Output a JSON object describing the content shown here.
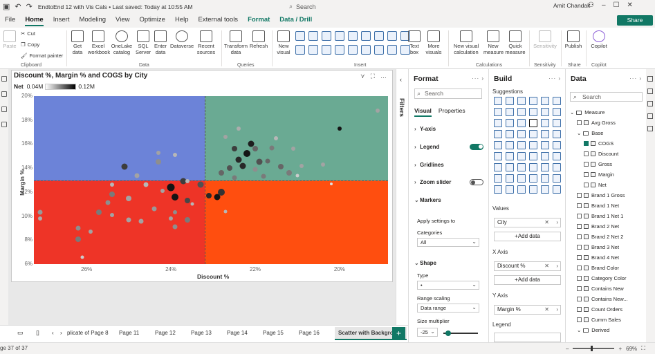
{
  "titlebar": {
    "file_title": "EndtoEnd 12 with Vis Cals • Last saved: Today at 10:55 AM",
    "search_placeholder": "Search",
    "user": "Amit Chandak"
  },
  "menu": {
    "tabs": [
      "File",
      "Home",
      "Insert",
      "Modeling",
      "View",
      "Optimize",
      "Help",
      "External tools",
      "Format",
      "Data / Drill"
    ],
    "active": "Home",
    "share_label": "Share"
  },
  "ribbon": {
    "clipboard": {
      "paste": "Paste",
      "cut": "Cut",
      "copy": "Copy",
      "format_painter": "Format painter",
      "group": "Clipboard"
    },
    "data": {
      "get_data": "Get data",
      "excel": "Excel workbook",
      "onelake": "OneLake catalog",
      "sql": "SQL Server",
      "enter": "Enter data",
      "dataverse": "Dataverse",
      "recent": "Recent sources",
      "group": "Data"
    },
    "queries": {
      "transform": "Transform data",
      "refresh": "Refresh",
      "group": "Queries"
    },
    "insert": {
      "new_visual": "New visual",
      "text_box": "Text box",
      "more_visuals": "More visuals",
      "group": "Insert"
    },
    "calculations": {
      "new_visual_calc": "New visual calculation",
      "new_measure": "New measure",
      "quick_measure": "Quick measure",
      "group": "Calculations"
    },
    "sensitivity": {
      "label": "Sensitivity",
      "group": "Sensitivity"
    },
    "share": {
      "publish": "Publish",
      "group": "Share"
    },
    "copilot": {
      "label": "Copilot",
      "group": "Copilot"
    }
  },
  "visual": {
    "title": "Discount %, Margin % and COGS by City",
    "legend_title": "Net",
    "legend_min": "0.04M",
    "legend_max": "0.12M",
    "quadrant_colors": {
      "top_left": "#6c83d8",
      "top_right": "#6aaa93",
      "bottom_left": "#ee3427",
      "bottom_right": "#ff4e0f"
    }
  },
  "chart_data": {
    "type": "scatter",
    "title": "Discount %, Margin % and COGS by City",
    "xlabel": "Discount %",
    "ylabel": "Margin %",
    "x_reversed": true,
    "xlim": [
      27.25,
      18.85
    ],
    "ylim": [
      6,
      20
    ],
    "x_ticks": [
      "26%",
      "24%",
      "22%",
      "20%"
    ],
    "y_ticks": [
      "20%",
      "18%",
      "16%",
      "14%",
      "12%",
      "10%",
      "8%",
      "6%"
    ],
    "x_tick_values": [
      26,
      24,
      22,
      20
    ],
    "y_tick_values": [
      20,
      18,
      16,
      14,
      12,
      10,
      8,
      6
    ],
    "reference_x": 23.2,
    "reference_y": 13.0,
    "grid": false,
    "legend": "top-left gradient",
    "points": [
      {
        "x": 22.8,
        "y": 12.0,
        "shade": 0.85,
        "size": 10
      },
      {
        "x": 23.7,
        "y": 12.9,
        "shade": 0.8,
        "size": 9
      },
      {
        "x": 24.0,
        "y": 12.4,
        "shade": 1.0,
        "size": 11
      },
      {
        "x": 23.3,
        "y": 12.6,
        "shade": 0.7,
        "size": 9
      },
      {
        "x": 22.9,
        "y": 11.6,
        "shade": 1.0,
        "size": 9
      },
      {
        "x": 23.9,
        "y": 11.6,
        "shade": 1.0,
        "size": 10
      },
      {
        "x": 23.6,
        "y": 11.3,
        "shade": 0.75,
        "size": 8
      },
      {
        "x": 23.1,
        "y": 11.7,
        "shade": 0.9,
        "size": 8
      },
      {
        "x": 22.4,
        "y": 14.7,
        "shade": 0.9,
        "size": 9
      },
      {
        "x": 22.2,
        "y": 15.2,
        "shade": 1.0,
        "size": 10
      },
      {
        "x": 22.3,
        "y": 14.2,
        "shade": 0.9,
        "size": 9
      },
      {
        "x": 21.9,
        "y": 14.5,
        "shade": 0.7,
        "size": 9
      },
      {
        "x": 22.0,
        "y": 15.6,
        "shade": 0.6,
        "size": 8
      },
      {
        "x": 22.6,
        "y": 14.0,
        "shade": 0.7,
        "size": 8
      },
      {
        "x": 22.8,
        "y": 13.6,
        "shade": 0.6,
        "size": 8
      },
      {
        "x": 22.1,
        "y": 16.0,
        "shade": 0.95,
        "size": 9
      },
      {
        "x": 22.5,
        "y": 15.6,
        "shade": 0.8,
        "size": 8
      },
      {
        "x": 21.4,
        "y": 14.1,
        "shade": 0.6,
        "size": 8
      },
      {
        "x": 21.2,
        "y": 13.6,
        "shade": 0.5,
        "size": 8
      },
      {
        "x": 21.8,
        "y": 13.3,
        "shade": 0.5,
        "size": 7
      },
      {
        "x": 21.6,
        "y": 15.7,
        "shade": 0.5,
        "size": 7
      },
      {
        "x": 21.7,
        "y": 14.6,
        "shade": 0.6,
        "size": 7
      },
      {
        "x": 22.0,
        "y": 13.9,
        "shade": 0.4,
        "size": 7
      },
      {
        "x": 22.5,
        "y": 13.2,
        "shade": 0.5,
        "size": 7
      },
      {
        "x": 21.1,
        "y": 15.6,
        "shade": 0.3,
        "size": 6
      },
      {
        "x": 20.9,
        "y": 14.2,
        "shade": 0.3,
        "size": 6
      },
      {
        "x": 22.7,
        "y": 16.6,
        "shade": 0.3,
        "size": 6
      },
      {
        "x": 22.4,
        "y": 17.3,
        "shade": 0.25,
        "size": 6
      },
      {
        "x": 21.5,
        "y": 16.5,
        "shade": 0.2,
        "size": 6
      },
      {
        "x": 20.0,
        "y": 17.3,
        "shade": 1.0,
        "size": 6
      },
      {
        "x": 19.1,
        "y": 18.8,
        "shade": 0.3,
        "size": 6
      },
      {
        "x": 20.4,
        "y": 14.3,
        "shade": 0.3,
        "size": 6
      },
      {
        "x": 20.2,
        "y": 12.7,
        "shade": 0.0,
        "size": 4
      },
      {
        "x": 24.3,
        "y": 14.5,
        "shade": 0.4,
        "size": 8
      },
      {
        "x": 25.1,
        "y": 14.1,
        "shade": 0.8,
        "size": 9
      },
      {
        "x": 24.8,
        "y": 13.4,
        "shade": 0.3,
        "size": 7
      },
      {
        "x": 24.6,
        "y": 12.6,
        "shade": 0.2,
        "size": 7
      },
      {
        "x": 23.9,
        "y": 15.1,
        "shade": 0.2,
        "size": 6
      },
      {
        "x": 24.3,
        "y": 15.3,
        "shade": 0.3,
        "size": 6
      },
      {
        "x": 25.4,
        "y": 12.6,
        "shade": 0.2,
        "size": 6
      },
      {
        "x": 25.0,
        "y": 11.5,
        "shade": 0.3,
        "size": 8
      },
      {
        "x": 25.4,
        "y": 11.8,
        "shade": 0.5,
        "size": 8
      },
      {
        "x": 25.7,
        "y": 10.3,
        "shade": 0.5,
        "size": 8
      },
      {
        "x": 25.5,
        "y": 11.1,
        "shade": 0.4,
        "size": 7
      },
      {
        "x": 24.4,
        "y": 10.6,
        "shade": 0.35,
        "size": 7
      },
      {
        "x": 24.7,
        "y": 9.6,
        "shade": 0.3,
        "size": 7
      },
      {
        "x": 24.0,
        "y": 9.8,
        "shade": 0.3,
        "size": 6
      },
      {
        "x": 23.6,
        "y": 9.7,
        "shade": 0.5,
        "size": 8
      },
      {
        "x": 23.9,
        "y": 9.1,
        "shade": 0.4,
        "size": 7
      },
      {
        "x": 24.2,
        "y": 12.1,
        "shade": 0.3,
        "size": 6
      },
      {
        "x": 25.0,
        "y": 9.7,
        "shade": 0.3,
        "size": 7
      },
      {
        "x": 25.9,
        "y": 8.7,
        "shade": 0.3,
        "size": 6
      },
      {
        "x": 26.2,
        "y": 9.0,
        "shade": 0.4,
        "size": 7
      },
      {
        "x": 26.2,
        "y": 8.1,
        "shade": 0.5,
        "size": 8
      },
      {
        "x": 25.4,
        "y": 10.1,
        "shade": 0.3,
        "size": 6
      },
      {
        "x": 27.1,
        "y": 10.3,
        "shade": 0.35,
        "size": 7
      },
      {
        "x": 27.1,
        "y": 9.8,
        "shade": 0.25,
        "size": 6
      },
      {
        "x": 26.1,
        "y": 6.6,
        "shade": 0.1,
        "size": 5
      },
      {
        "x": 23.9,
        "y": 10.3,
        "shade": 0.4,
        "size": 6
      },
      {
        "x": 23.6,
        "y": 12.9,
        "shade": 0.2,
        "size": 6
      },
      {
        "x": 23.5,
        "y": 11.0,
        "shade": 0.2,
        "size": 5
      },
      {
        "x": 22.7,
        "y": 10.4,
        "shade": 0.2,
        "size": 5
      },
      {
        "x": 21.0,
        "y": 13.4,
        "shade": 0.1,
        "size": 5
      }
    ]
  },
  "filters_label": "Filters",
  "format_pane": {
    "title": "Format",
    "search_placeholder": "Search",
    "tabs": [
      "Visual",
      "Properties"
    ],
    "sections": [
      "Y-axis",
      "Legend",
      "Gridlines",
      "Zoom slider",
      "Markers"
    ],
    "legend_toggle": "On",
    "zoom_toggle": "Off",
    "apply_settings_to": "Apply settings to",
    "categories_label": "Categories",
    "categories_value": "All",
    "shape_label": "Shape",
    "type_label": "Type",
    "type_value": "•",
    "range_scaling_label": "Range scaling",
    "range_scaling_value": "Data range",
    "size_multiplier_label": "Size multiplier",
    "size_multiplier_value": "-25"
  },
  "build_pane": {
    "title": "Build",
    "suggestions": "Suggestions",
    "values_label": "Values",
    "values_field": "City",
    "xaxis_label": "X Axis",
    "xaxis_field": "Discount %",
    "yaxis_label": "Y Axis",
    "yaxis_field": "Margin %",
    "legend_label": "Legend",
    "add_data": "+Add data"
  },
  "data_pane": {
    "title": "Data",
    "search_placeholder": "Search",
    "items": [
      {
        "label": "Measure",
        "type": "folder",
        "level": 0
      },
      {
        "label": "Avg Gross",
        "type": "calc",
        "level": 1
      },
      {
        "label": "Base",
        "type": "folder",
        "level": 1
      },
      {
        "label": "COGS",
        "type": "calc",
        "level": 2,
        "checked": true
      },
      {
        "label": "Discount",
        "type": "calc",
        "level": 2
      },
      {
        "label": "Gross",
        "type": "calc",
        "level": 2
      },
      {
        "label": "Margin",
        "type": "calc",
        "level": 2
      },
      {
        "label": "Net",
        "type": "calc",
        "level": 2
      },
      {
        "label": "Brand 1 Gross",
        "type": "calc",
        "level": 1
      },
      {
        "label": "Brand 1 Net",
        "type": "calc",
        "level": 1
      },
      {
        "label": "Brand 1 Net 1",
        "type": "calc",
        "level": 1
      },
      {
        "label": "Brand 2 Net",
        "type": "calc",
        "level": 1
      },
      {
        "label": "Brand 2 Net 2",
        "type": "calc",
        "level": 1
      },
      {
        "label": "Brand 3 Net",
        "type": "calc",
        "level": 1
      },
      {
        "label": "Brand 4 Net",
        "type": "calc",
        "level": 1
      },
      {
        "label": "Brand Color",
        "type": "calc",
        "level": 1
      },
      {
        "label": "Category Color",
        "type": "calc",
        "level": 1
      },
      {
        "label": "Contains New",
        "type": "calc",
        "level": 1
      },
      {
        "label": "Contains New...",
        "type": "calc",
        "level": 1
      },
      {
        "label": "Count Orders",
        "type": "calc",
        "level": 1
      },
      {
        "label": "Cumm Sales",
        "type": "calc",
        "level": 1
      },
      {
        "label": "Derived",
        "type": "folder",
        "level": 1
      }
    ]
  },
  "pages": {
    "tabs": [
      "plicate of Page 8",
      "Page 11",
      "Page 12",
      "Page 13",
      "Page 14",
      "Page 15",
      "Page 16",
      "Scatter with Background"
    ],
    "active": "Scatter with Background"
  },
  "status": {
    "page_indicator": "ge 37 of 37",
    "zoom": "69%"
  }
}
